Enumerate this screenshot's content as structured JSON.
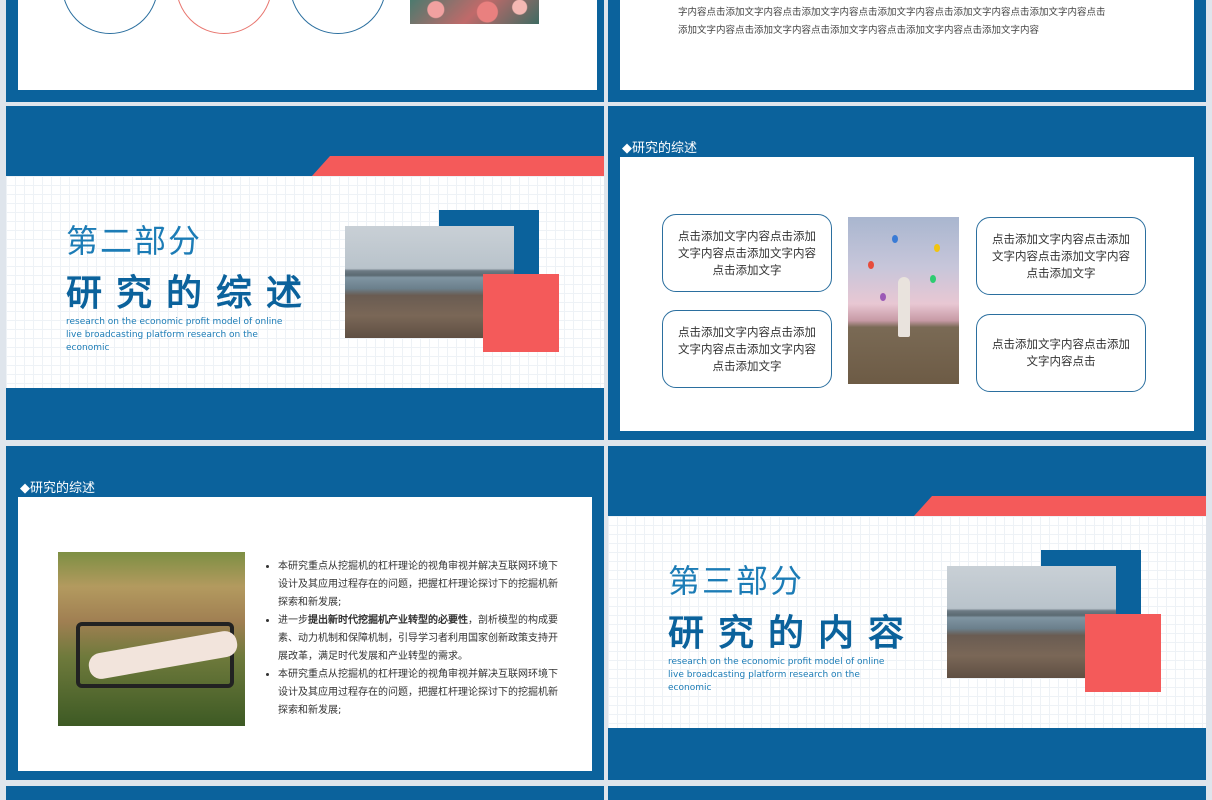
{
  "colors": {
    "primary_blue": "#0b629c",
    "accent_coral": "#f45a5a",
    "text_blue": "#1c7cb6"
  },
  "slide_top_right": {
    "body_line1": "字内容点击添加文字内容点击添加文字内容点击添加文字内容点击添加文字内容点击添加文字内容点击",
    "body_line2": "添加文字内容点击添加文字内容点击添加文字内容点击添加文字内容点击添加文字内容"
  },
  "slide_section2": {
    "title_small": "第二部分",
    "title_big": "研究的综述",
    "subtitle": "research on the economic profit model of online live broadcasting platform research on the economic"
  },
  "slide_overview_boxes": {
    "heading": "◆研究的综述",
    "boxes": [
      "点击添加文字内容点击添加文字内容点击添加文字内容点击添加文字",
      "点击添加文字内容点击添加文字内容点击添加文字内容点击添加文字",
      "点击添加文字内容点击添加文字内容点击添加文字内容点击添加文字",
      "点击添加文字内容点击添加文字内容点击"
    ]
  },
  "slide_overview_text": {
    "heading": "◆研究的综述",
    "bullets": [
      {
        "pre": "本研究重点从挖掘机的杠杆理论的视角审视并解决互联网环境下设计及其应用过程存在的问题，把握杠杆理论探讨下的挖掘机新探索和新发展;",
        "bold": "",
        "post": ""
      },
      {
        "pre": "进一步",
        "bold": "提出新时代挖掘机产业转型的必要性",
        "post": "，剖析模型的构成要素、动力机制和保障机制，引导学习者利用国家创新政策支持开展改革，满足时代发展和产业转型的需求。"
      },
      {
        "pre": "本研究重点从挖掘机的杠杆理论的视角审视并解决互联网环境下设计及其应用过程存在的问题，把握杠杆理论探讨下的挖掘机新探索和新发展;",
        "bold": "",
        "post": ""
      }
    ]
  },
  "slide_section3": {
    "title_small": "第三部分",
    "title_big": "研究的内容",
    "subtitle": "research on the economic profit model of online live broadcasting platform research on the economic"
  }
}
